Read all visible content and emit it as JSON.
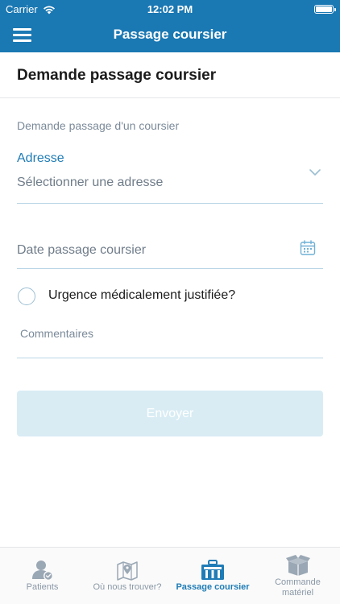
{
  "status_bar": {
    "carrier": "Carrier",
    "time": "12:02 PM"
  },
  "nav": {
    "title": "Passage coursier",
    "menu_icon": "hamburger-menu-icon"
  },
  "section": {
    "title": "Demande passage coursier"
  },
  "form": {
    "caption": "Demande passage d'un coursier",
    "address_label": "Adresse",
    "address_value": "Sélectionner une adresse",
    "date_placeholder": "Date passage coursier",
    "urgent_label": "Urgence médicalement justifiée?",
    "urgent_checked": false,
    "comment_label": "Commentaires",
    "comment_value": "",
    "submit_label": "Envoyer"
  },
  "tabs": [
    {
      "label": "Patients",
      "icon": "patient-icon",
      "active": false
    },
    {
      "label": "Où nous trouver?",
      "icon": "map-icon",
      "active": false
    },
    {
      "label": "Passage coursier",
      "icon": "courier-icon",
      "active": true
    },
    {
      "label": "Commande matériel",
      "icon": "box-icon",
      "active": false
    }
  ],
  "colors": {
    "primary": "#1a78b3",
    "accent_text": "#1f7cb6",
    "button_disabled": "#d9ecf4",
    "field_line": "#b9d6e6"
  }
}
